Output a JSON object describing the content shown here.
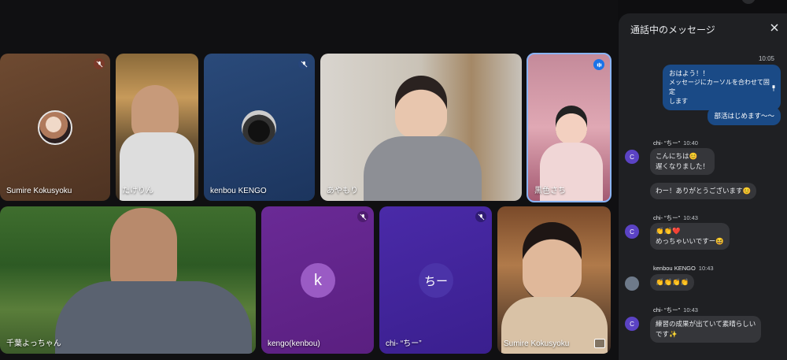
{
  "participants": [
    {
      "name": "Sumire Kokusyoku",
      "muted": true
    },
    {
      "name": "たけりん",
      "muted": false
    },
    {
      "name": "kenbou KENGO",
      "muted": true
    },
    {
      "name": "あやもり",
      "muted": false
    },
    {
      "name": "黒色さち",
      "muted": false,
      "speaking": true
    },
    {
      "name": "千葉よっちゃん",
      "muted": false
    },
    {
      "name": "kengo(kenbou)",
      "muted": true,
      "initial": "k"
    },
    {
      "name": "chi- “ちー”",
      "muted": true,
      "initial": "ちー"
    },
    {
      "name": "Sumire Kokusyoku",
      "muted": false
    }
  ],
  "chat": {
    "title": "通話中のメッセージ",
    "my_time": "10:05",
    "my_msg1_line1": "おはよう！！",
    "my_msg1_line2": "メッセージにカーソルを合わせて固定",
    "my_msg1_line3": "します",
    "my_msg2": "部活はじめます〜〜",
    "groups": [
      {
        "initial": "C",
        "sender": "chi- “ちー”",
        "time": "10:40",
        "msgs": [
          "こんにちは😊",
          "遅くなりました！",
          "わー！ありがとうございます😊"
        ]
      },
      {
        "initial": "C",
        "sender": "chi- “ちー”",
        "time": "10:43",
        "msgs": [
          "👏👏❤️",
          "めっちゃいいですー😆"
        ]
      },
      {
        "initial": "",
        "sender": "kenbou KENGO",
        "time": "10:43",
        "msgs": [
          "👏👏👏👏"
        ]
      },
      {
        "initial": "C",
        "sender": "chi- “ちー”",
        "time": "10:43",
        "msgs": [
          "練習の成果が出ていて素晴らしい",
          "です✨"
        ]
      }
    ]
  },
  "colors": {
    "accent_purple": "#6b2a9a",
    "accent_indigo": "#3a2aa0",
    "chat_bubble_me": "#1a4a86",
    "chat_bubble_other": "#35363a",
    "panel_bg": "#1f2023"
  }
}
